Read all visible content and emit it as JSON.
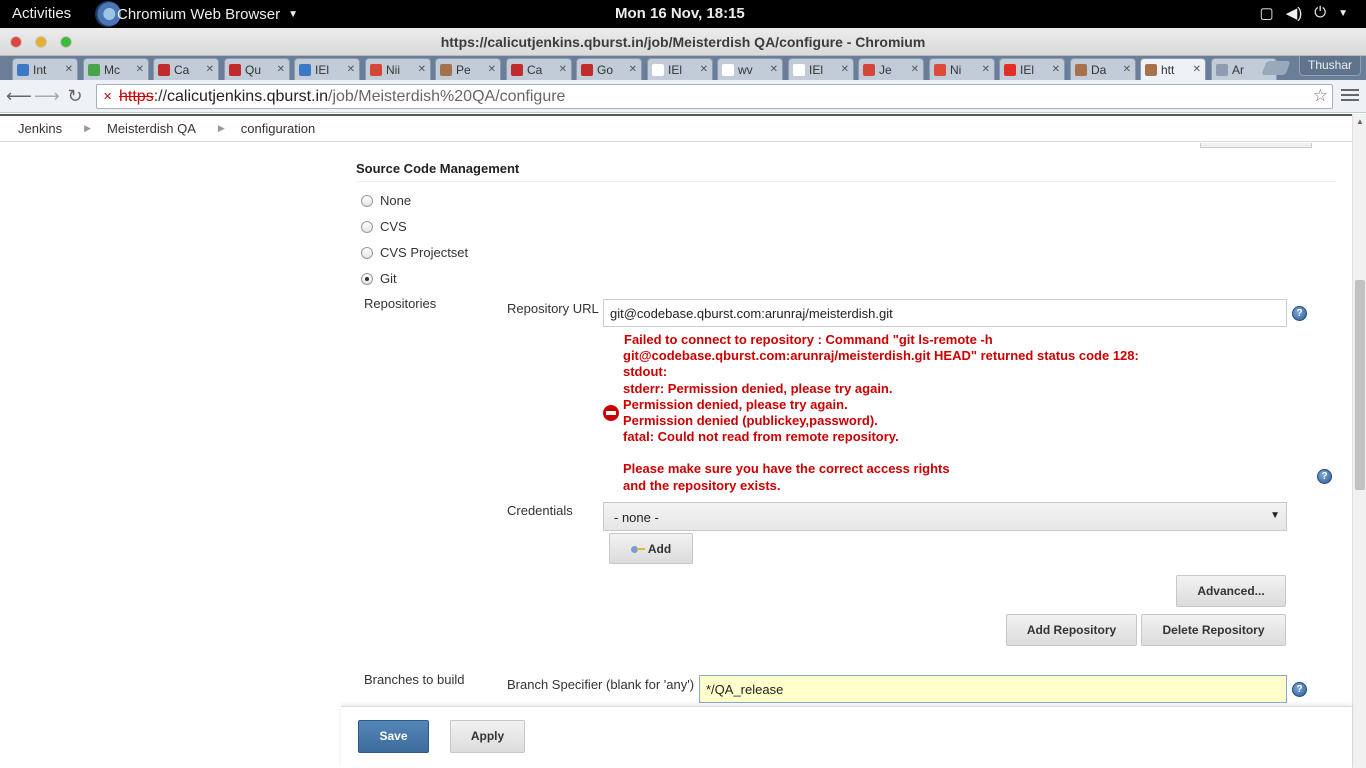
{
  "system_bar": {
    "activities": "Activities",
    "app_name": "Chromium Web Browser",
    "clock": "Mon 16 Nov, 18:15"
  },
  "window": {
    "title": "https://calicutjenkins.qburst.in/job/Meisterdish QA/configure - Chromium"
  },
  "tabs": [
    {
      "label": "Int",
      "favicon_color": "#3b79c4"
    },
    {
      "label": "Mc",
      "favicon_color": "#4aa54a"
    },
    {
      "label": "Ca",
      "favicon_color": "#c02b2b"
    },
    {
      "label": "Qu",
      "favicon_color": "#c02b2b"
    },
    {
      "label": "IEl",
      "favicon_color": "#3b79c4"
    },
    {
      "label": "Nii",
      "favicon_color": "#d44638"
    },
    {
      "label": "Pe",
      "favicon_color": "#a5724b"
    },
    {
      "label": "Ca",
      "favicon_color": "#c02b2b"
    },
    {
      "label": "Go",
      "favicon_color": "#c02b2b"
    },
    {
      "label": "IEl",
      "favicon_color": "#ffffff"
    },
    {
      "label": "wv",
      "favicon_color": "#ffffff"
    },
    {
      "label": "IEl",
      "favicon_color": "#ffffff"
    },
    {
      "label": "Je",
      "favicon_color": "#d44638"
    },
    {
      "label": "Ni",
      "favicon_color": "#dd4b39"
    },
    {
      "label": "IEl",
      "favicon_color": "#e52d27"
    },
    {
      "label": "Da",
      "favicon_color": "#a5724b"
    },
    {
      "label": "htt",
      "favicon_color": "#a5724b",
      "active": true
    },
    {
      "label": "Ar",
      "favicon_color": "#8e9bb0"
    }
  ],
  "profile": "Thushar",
  "address_bar": {
    "scheme": "https",
    "host": "calicutjenkins.qburst.in",
    "path": "/job/Meisterdish%20QA/configure"
  },
  "breadcrumbs": [
    "Jenkins",
    "Meisterdish QA",
    "configuration"
  ],
  "scm": {
    "section_title": "Source Code Management",
    "options": [
      {
        "label": "None",
        "checked": false
      },
      {
        "label": "CVS",
        "checked": false
      },
      {
        "label": "CVS Projectset",
        "checked": false
      },
      {
        "label": "Git",
        "checked": true
      }
    ],
    "repositories_label": "Repositories",
    "repo_url_label": "Repository URL",
    "repo_url_value": "git@codebase.qburst.com:arunraj/meisterdish.git",
    "error_lines": [
      "Failed to connect to repository : Command \"git ls-remote -h",
      "git@codebase.qburst.com:arunraj/meisterdish.git HEAD\" returned status code 128:",
      "stdout:",
      "stderr: Permission denied, please try again.",
      "Permission denied, please try again.",
      "Permission denied (publickey,password).",
      "fatal: Could not read from remote repository.",
      "",
      "Please make sure you have the correct access rights",
      "and the repository exists."
    ],
    "credentials_label": "Credentials",
    "credentials_value": "- none -",
    "add_label": "Add",
    "advanced_label": "Advanced...",
    "add_repository_label": "Add Repository",
    "delete_repository_label": "Delete Repository",
    "branches_label": "Branches to build",
    "branch_specifier_label": "Branch Specifier (blank for 'any')",
    "branch_specifier_value": "*/QA_release"
  },
  "footer": {
    "save_label": "Save",
    "apply_label": "Apply"
  },
  "colors": {
    "error": "#cc0000",
    "save_button": "#4a7aab",
    "highlight_field": "#ffffcc"
  }
}
